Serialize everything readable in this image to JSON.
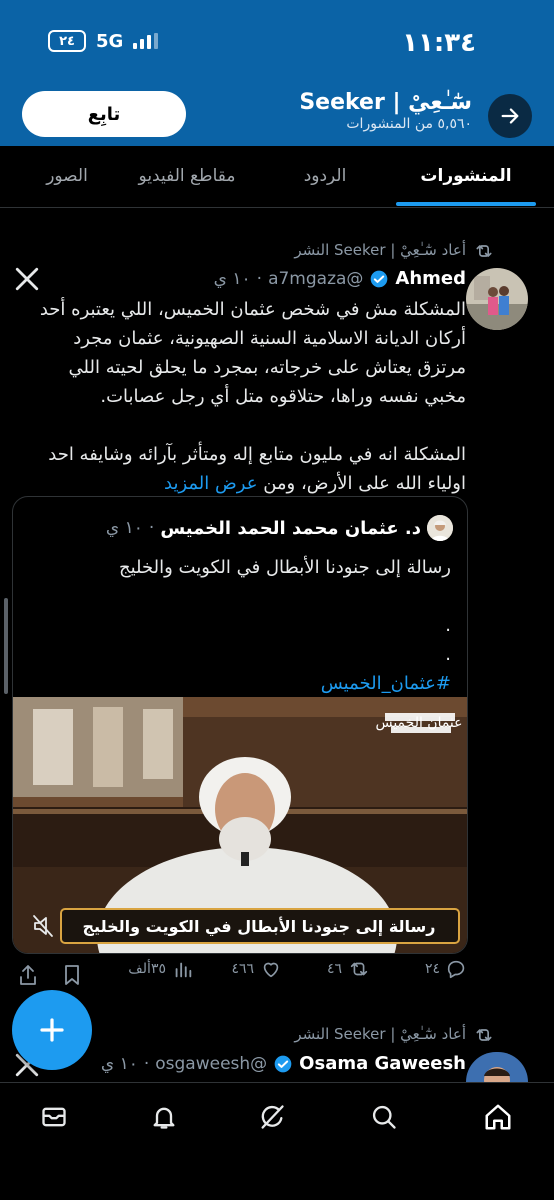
{
  "status_bar": {
    "time": "١١:٣٤",
    "battery": "٢٤",
    "network": "5G"
  },
  "header": {
    "back_icon": "arrow-right-icon",
    "title": "سٰٓـٰعِيْ | Seeker",
    "subtitle": "٥,٥٦٠ من المنشورات",
    "follow_label": "تابِع"
  },
  "tabs": [
    {
      "label": "المنشورات",
      "active": true
    },
    {
      "label": "الردود",
      "active": false
    },
    {
      "label": "مقاطع الفيديو",
      "active": false
    },
    {
      "label": "الصور",
      "active": false
    }
  ],
  "posts": [
    {
      "repost_label": "أعاد سٰٓـٰعِيْ | Seeker النشر",
      "author_name": "Ahmed",
      "author_handle": "@a7mgaza",
      "time": "١٠ ي",
      "paragraph_1": "المشكلة مش في شخص عثمان الخميس، اللي يعتبره أحد أركان الديانة الاسلامية السنية الصهيونية، عثمان مجرد مرتزق يعتاش على خرجاته، بمجرد ما يحلق لحيته اللي مخبي نفسه وراها، حتلاقوه متل أي رجل عصابات.",
      "paragraph_2": "المشكلة انه في مليون متابع إله ومتأثر بآرائه وشايفه احد اولياء الله على الأرض، ومن",
      "show_more": "عرض المزيد",
      "quote": {
        "author_name": "د. عثمان محمد الحمد الخميس",
        "time": "١٠ ي",
        "line_1": "رسالة إلى جنودنا الأبطال في الكويت والخليج",
        "dot_1": ".",
        "dot_2": ".",
        "hashtag": "#عثمان_الخميس",
        "video_caption": "رسالة إلى جنودنا الأبطال في الكويت والخليج",
        "video_logo_text": "عثمان الخميس"
      },
      "actions": {
        "replies": "٢٤",
        "reposts": "٤٦",
        "likes": "٤٦٦",
        "views": "٣٥ألف"
      }
    },
    {
      "repost_label": "أعاد سٰٓـٰعِيْ | Seeker النشر",
      "author_name": "Osama Gaweesh",
      "author_handle": "@osgaweesh",
      "time": "١٠ ي"
    }
  ],
  "colors": {
    "accent": "#1d9bf0",
    "header_bg": "#0b63a6",
    "background": "#000000",
    "muted_text": "#8b98a5"
  },
  "bottom_nav": [
    "home-icon",
    "search-icon",
    "grok-icon",
    "notifications-icon",
    "messages-icon"
  ]
}
